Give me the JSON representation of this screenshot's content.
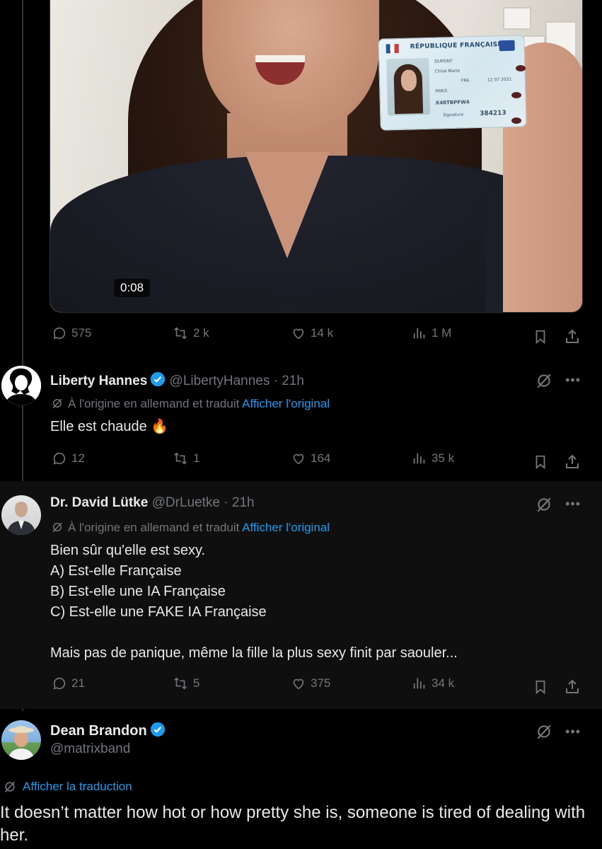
{
  "video": {
    "timestamp": "0:08",
    "idcard": {
      "header": "RÉPUBLIQUE FRANÇAISE",
      "surname": "DUPONT",
      "given": "Chloé Marie",
      "city": "PARIS",
      "nat": "FRA",
      "mrz": "X4RTBPFW4",
      "date": "12 07 2031",
      "number": "384213",
      "signature": "Signature"
    }
  },
  "main_stats": {
    "replies": "575",
    "reposts": "2 k",
    "likes": "14 k",
    "views": "1 M"
  },
  "replies": [
    {
      "name": "Liberty Hannes",
      "handle": "@LibertyHannes · 21h",
      "translation_note": "À l'origine en allemand et traduit",
      "show_original": "Afficher l'original",
      "text": "Elle est chaude 🔥",
      "stats": {
        "replies": "12",
        "reposts": "1",
        "likes": "164",
        "views": "35 k"
      }
    },
    {
      "name": "Dr. David Lütke",
      "handle": "@DrLuetke · 21h",
      "translation_note": "À l'origine en allemand et traduit",
      "show_original": "Afficher l'original",
      "text": "Bien sûr qu'elle est sexy.\nA) Est-elle Française\nB) Est-elle une IA Française\nC) Est-elle une FAKE IA Française\n\nMais pas de panique, même la fille la plus sexy finit par saouler...",
      "stats": {
        "replies": "21",
        "reposts": "5",
        "likes": "375",
        "views": "34 k"
      }
    }
  ],
  "quoted": {
    "name": "Dean Brandon",
    "handle": "@matrixband",
    "translate_link": "Afficher la traduction",
    "text": "It doesn’t matter how hot or how pretty she is, someone is tired of dealing with her."
  },
  "colors": {
    "accent": "#1d9bf0",
    "muted": "#71767b",
    "text": "#e7e9ea",
    "background": "#000000"
  }
}
